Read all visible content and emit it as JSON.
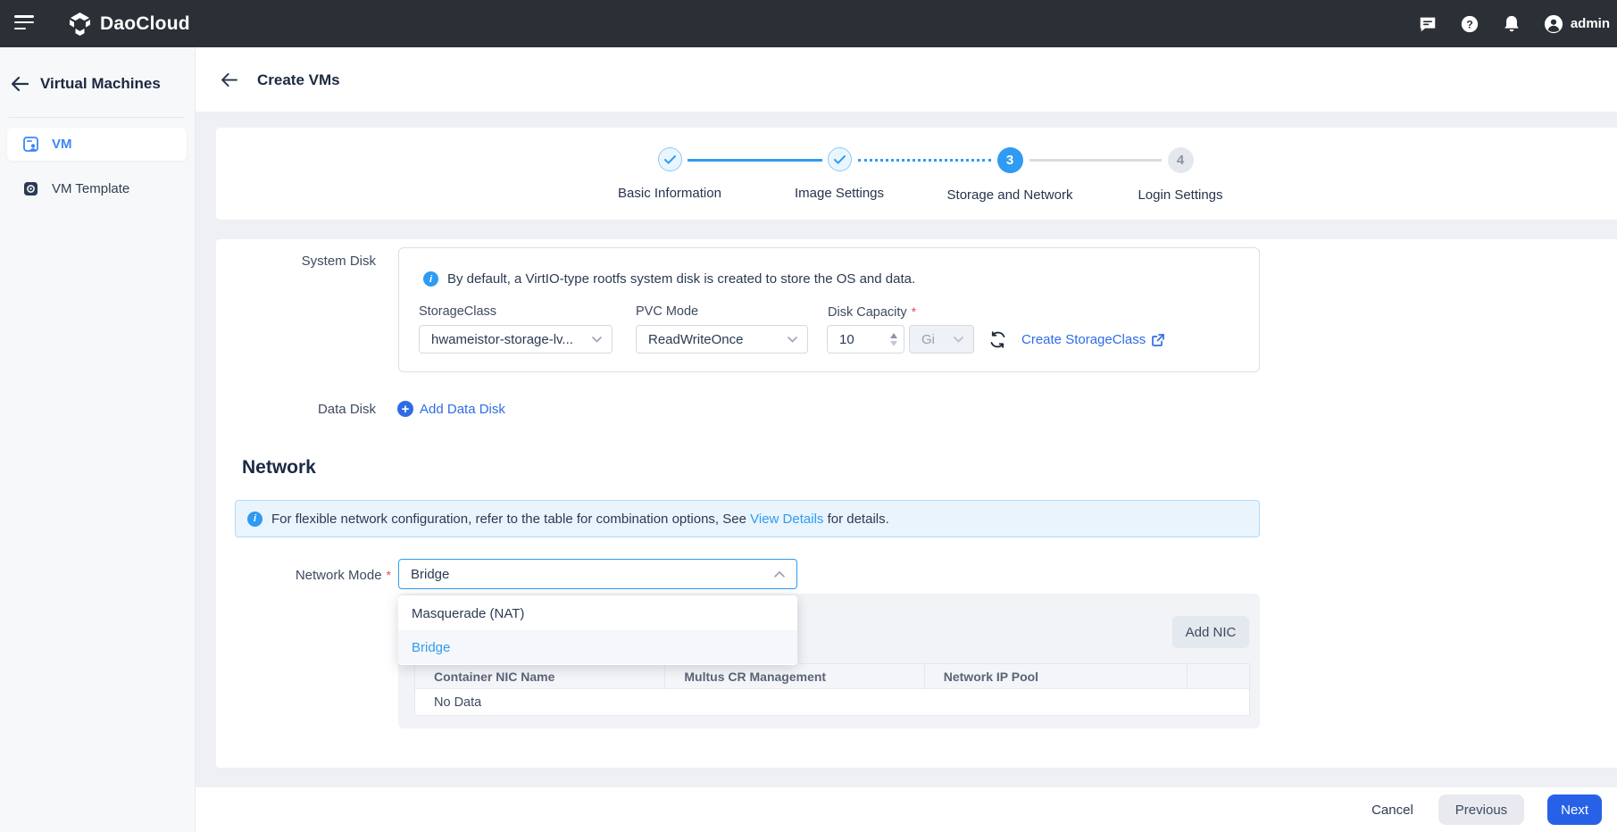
{
  "navbar": {
    "brand": "DaoCloud",
    "user": "admin"
  },
  "sidebar": {
    "title": "Virtual Machines",
    "items": [
      {
        "label": "VM"
      },
      {
        "label": "VM Template"
      }
    ]
  },
  "header": {
    "title": "Create VMs"
  },
  "stepper": {
    "steps": [
      {
        "label": "Basic Information",
        "state": "done"
      },
      {
        "label": "Image Settings",
        "state": "done"
      },
      {
        "label": "Storage and Network",
        "state": "current",
        "number": "3"
      },
      {
        "label": "Login Settings",
        "state": "pending",
        "number": "4"
      }
    ]
  },
  "form": {
    "system_disk": {
      "label": "System Disk",
      "info": "By default, a VirtIO-type rootfs system disk is created to store the OS and data.",
      "storage_class": {
        "label": "StorageClass",
        "value": "hwameistor-storage-lv..."
      },
      "pvc_mode": {
        "label": "PVC Mode",
        "value": "ReadWriteOnce"
      },
      "disk_capacity": {
        "label": "Disk Capacity",
        "required_mark": "*",
        "value": "10",
        "unit": "Gi"
      },
      "create_storageclass_link": "Create StorageClass"
    },
    "data_disk": {
      "label": "Data Disk",
      "add_link": "Add Data Disk"
    },
    "network": {
      "heading": "Network",
      "banner": {
        "text_before": "For flexible network configuration, refer to the table for combination options, See ",
        "link": "View Details",
        "text_after": " for details."
      },
      "network_mode": {
        "label": "Network Mode",
        "required_mark": "*",
        "value": "Bridge",
        "options": [
          "Masquerade (NAT)",
          "Bridge"
        ]
      },
      "nic_table": {
        "add_button": "Add NIC",
        "columns": [
          "Container NIC Name",
          "Multus CR Management",
          "Network IP Pool"
        ],
        "empty_text": "No Data"
      }
    }
  },
  "footer": {
    "cancel": "Cancel",
    "previous": "Previous",
    "next": "Next"
  },
  "colors": {
    "accent_blue": "#2f9bf2",
    "link_blue": "#2e6ce6",
    "primary_button": "#2661e8",
    "navbar_bg": "#2b3036",
    "required_red": "#e34d59"
  }
}
